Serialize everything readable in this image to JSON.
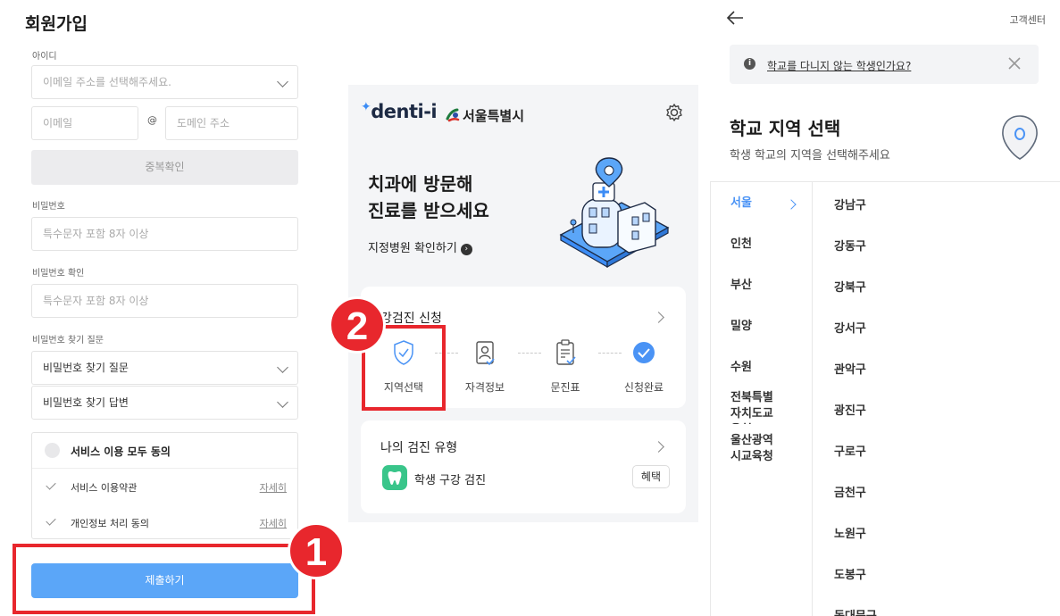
{
  "signup": {
    "title": "회원가입",
    "id_label": "아이디",
    "email_select_placeholder": "이메일 주소를 선택해주세요.",
    "email_local_placeholder": "이메일",
    "at_sign": "@",
    "email_domain_placeholder": "도메인 주소",
    "duplicate_check": "중복확인",
    "password_label": "비밀번호",
    "password_placeholder": "특수문자 포함 8자 이상",
    "password_confirm_label": "비밀번호 확인",
    "password_confirm_placeholder": "특수문자 포함 8자 이상",
    "hint_label": "비밀번호 찾기 질문",
    "hint_question_value": "비밀번호 찾기 질문",
    "hint_answer_value": "비밀번호 찾기 답변",
    "agree_all": "서비스 이용 모두 동의",
    "terms": [
      {
        "label": "서비스 이용약관",
        "detail": "자세히"
      },
      {
        "label": "개인정보 처리 동의",
        "detail": "자세히"
      }
    ],
    "submit": "제출하기"
  },
  "annotations": {
    "badge_1": "1",
    "badge_2": "2",
    "highlight_color": "#e8272d"
  },
  "denti": {
    "logo": "denti-i",
    "partner": "서울특별시",
    "hero_line1": "치과에 방문해",
    "hero_line2": "진료를 받으세요",
    "hero_link": "지정병원 확인하기",
    "apply_title": "강검진 신청",
    "steps": [
      {
        "label": "지역선택",
        "icon": "shield-check-icon"
      },
      {
        "label": "자격정보",
        "icon": "id-person-icon"
      },
      {
        "label": "문진표",
        "icon": "clipboard-check-icon"
      },
      {
        "label": "신청완료",
        "icon": "check-circle-icon"
      }
    ],
    "type_title": "나의 검진 유형",
    "type_value": "학생 구강 검진",
    "perk": "혜택",
    "accent": "#4a93f5"
  },
  "region": {
    "customer_center": "고객센터",
    "notice": "학교를 다니지 않는 학생인가요?",
    "title": "학교 지역 선택",
    "subtitle": "학생 학교의 지역을 선택해주세요",
    "cities": [
      "서울",
      "인천",
      "부산",
      "밀양",
      "수원",
      "전북특별\n자치도교\n육청",
      "울산광역\n시교육청"
    ],
    "districts": [
      "강남구",
      "강동구",
      "강북구",
      "강서구",
      "관악구",
      "광진구",
      "구로구",
      "금천구",
      "노원구",
      "도봉구",
      "동대문구"
    ]
  }
}
